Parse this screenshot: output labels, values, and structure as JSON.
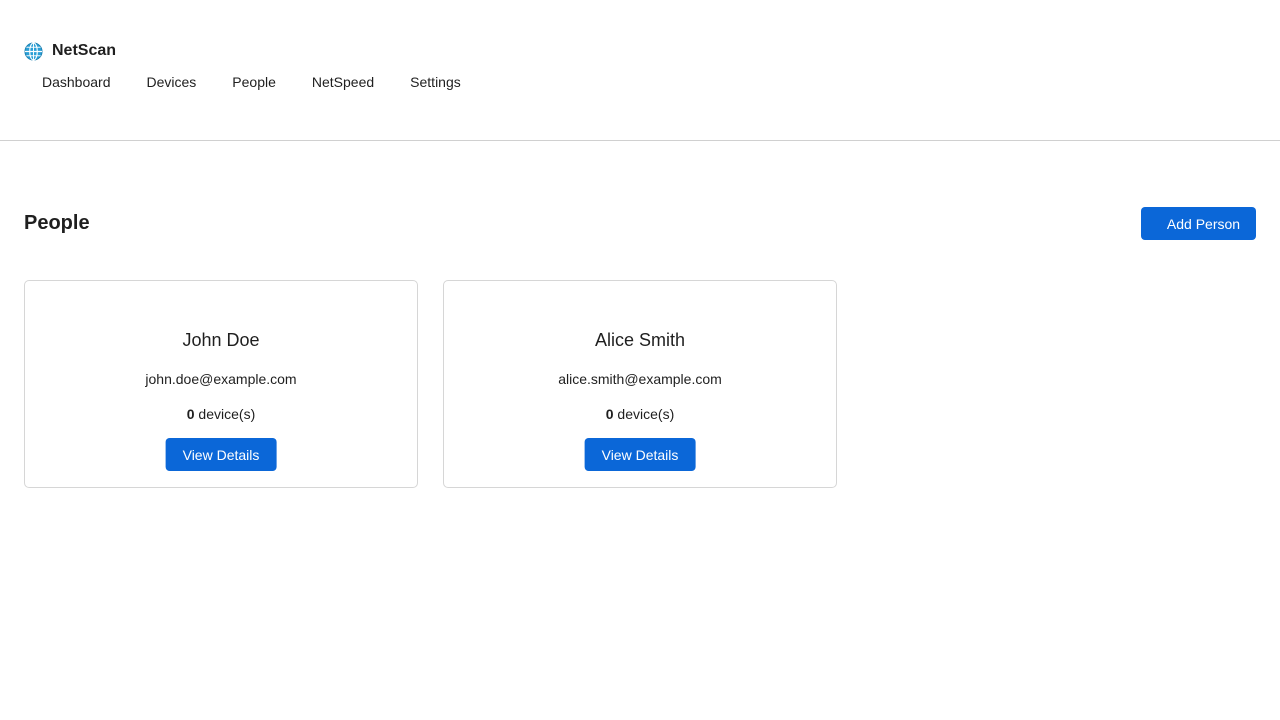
{
  "brand": {
    "icon": "globe-icon",
    "name": "NetScan"
  },
  "nav": {
    "items": [
      {
        "label": "Dashboard"
      },
      {
        "label": "Devices"
      },
      {
        "label": "People"
      },
      {
        "label": "NetSpeed"
      },
      {
        "label": "Settings"
      }
    ]
  },
  "page": {
    "title": "People",
    "add_button_label": "Add Person"
  },
  "people": [
    {
      "name": "John Doe",
      "email": "john.doe@example.com",
      "device_count": "0",
      "device_suffix": " device(s)",
      "button_label": "View Details"
    },
    {
      "name": "Alice Smith",
      "email": "alice.smith@example.com",
      "device_count": "0",
      "device_suffix": " device(s)",
      "button_label": "View Details"
    }
  ],
  "colors": {
    "accent": "#0b67d8",
    "text": "#1f1f1f",
    "border": "#d6d6d6",
    "globe": "#2a9fd6"
  }
}
